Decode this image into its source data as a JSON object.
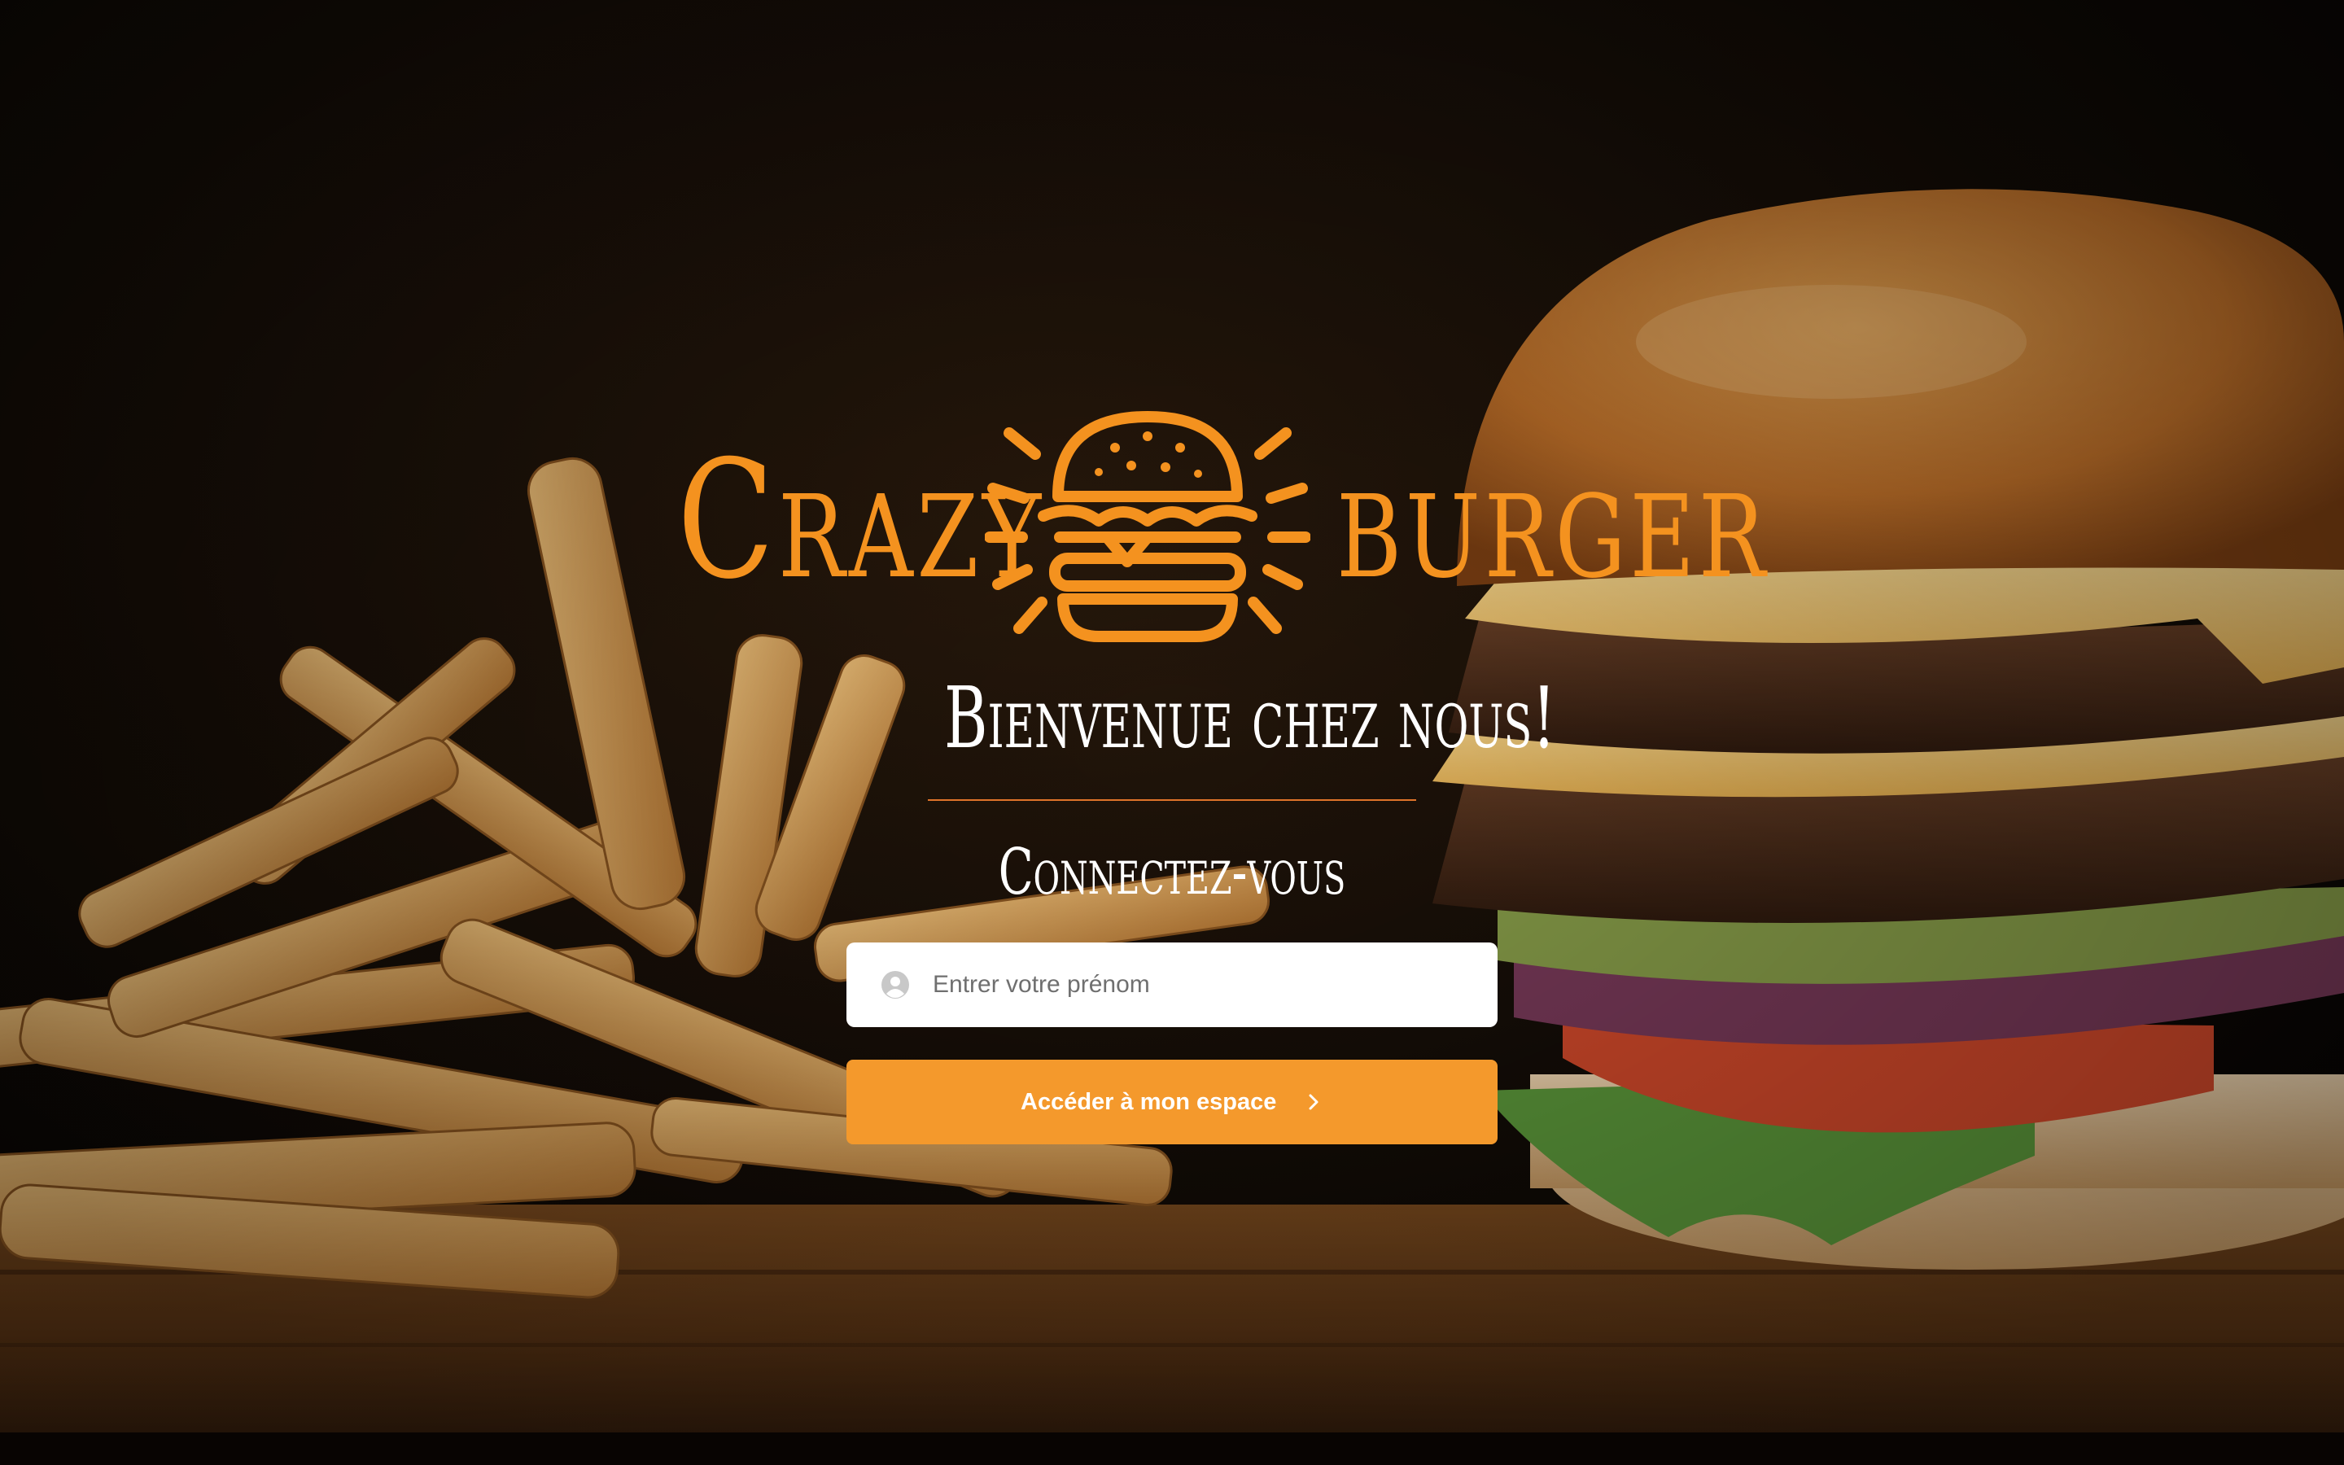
{
  "brand": {
    "word_left": "Crazy",
    "word_right": "burger",
    "logo_icon": "burger-icon",
    "accent_color": "#f4921f"
  },
  "welcome": {
    "title": "Bienvenue chez nous!",
    "subtitle": "Connectez-vous"
  },
  "login_form": {
    "name_input": {
      "value": "",
      "placeholder": "Entrer votre prénom",
      "icon": "user-circle-icon"
    },
    "submit_button": {
      "label": "Accéder à mon espace",
      "icon": "chevron-right-icon",
      "color": "#f4992c"
    }
  },
  "background": {
    "image": "burger-and-fries-photo"
  }
}
